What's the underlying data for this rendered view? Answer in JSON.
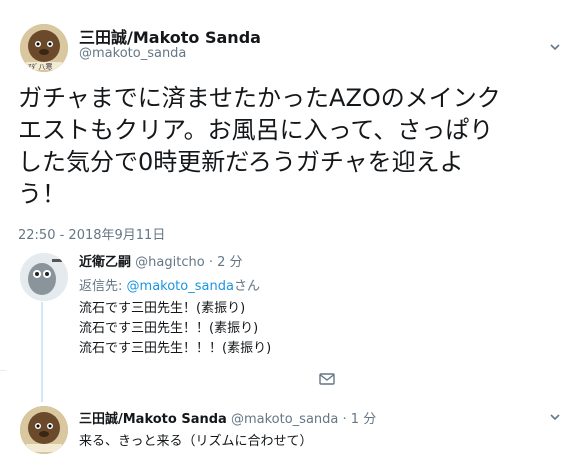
{
  "main_tweet": {
    "display_name": "三田誠/Makoto Sanda",
    "handle": "@makoto_sanda",
    "text_lines": [
      "ガチャまでに済ませたかったAZOのメインク",
      "エストもクリア。お風呂に入って、さっぱり",
      "した気分で0時更新だろうガチャを迎えよ",
      "う！"
    ],
    "timestamp": "22:50 - 2018年9月11日"
  },
  "reply_1": {
    "display_name": "近衛乙嗣",
    "handle": "@hagitcho",
    "separator": "·",
    "time": "2 分",
    "reply_to_label": "返信先:",
    "reply_to_handle": "@makoto_sanda",
    "reply_to_suffix": "さん",
    "lines": [
      "流石です三田先生！(素振り)",
      "流石です三田先生！！(素振り)",
      "流石です三田先生！！！(素振り)"
    ]
  },
  "reply_2": {
    "display_name": "三田誠/Makoto Sanda",
    "handle": "@makoto_sanda",
    "separator": "·",
    "time": "1 分",
    "text": "来る、きっと来る（リズムに合わせて）"
  },
  "avatar_caption": "ｱﾀﾞ八寒",
  "icons": [
    "chevron-down-icon",
    "envelope-icon"
  ],
  "colors": {
    "link": "#1b95e0",
    "muted": "#657786",
    "thread": "#cfe8f7"
  }
}
